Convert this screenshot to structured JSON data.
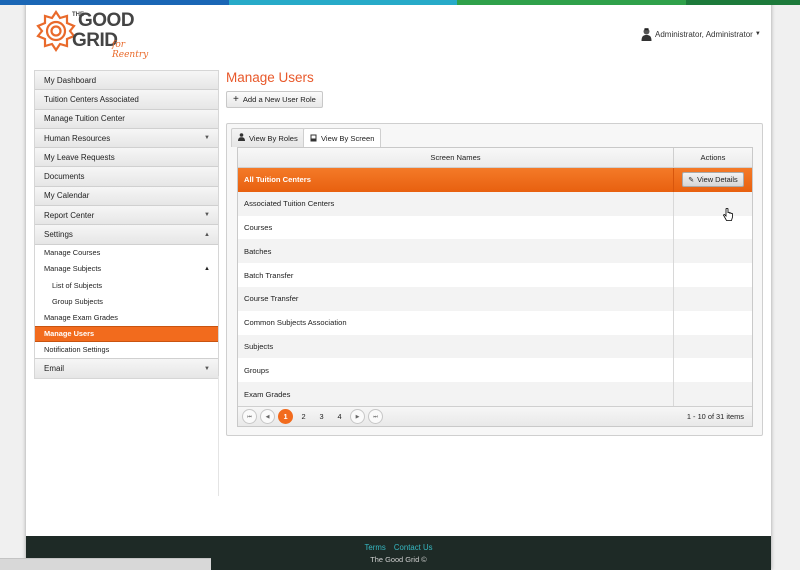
{
  "colors": {
    "topbar": [
      "#1a66b5",
      "#1a66b5",
      "#27aac8",
      "#27aac8",
      "#2fa14a",
      "#2fa14a",
      "#1d7a3b"
    ],
    "accent": "#f26b1d",
    "title": "#e8582a",
    "footer_link": "#36b8c2"
  },
  "logo": {
    "the": "THE",
    "good": "GOOD",
    "grid": "GRID",
    "tagline": "for Reentry"
  },
  "header": {
    "user_label": "Administrator, Administrator",
    "user_icon": "user-icon",
    "caret_icon": "caret-down-icon"
  },
  "sidebar": {
    "items": [
      {
        "label": "My Dashboard"
      },
      {
        "label": "Tuition Centers Associated"
      },
      {
        "label": "Manage Tuition Center"
      },
      {
        "label": "Human Resources",
        "arrow": "▼"
      },
      {
        "label": "My Leave Requests"
      },
      {
        "label": "Documents"
      },
      {
        "label": "My Calendar"
      },
      {
        "label": "Report Center",
        "arrow": "▼"
      },
      {
        "label": "Settings",
        "arrow": "▲"
      }
    ],
    "settings_sub": [
      {
        "label": "Manage Courses"
      },
      {
        "label": "Manage Subjects",
        "arrow": "▲"
      },
      {
        "label": "List of Subjects"
      },
      {
        "label": "Group Subjects"
      },
      {
        "label": "Manage Exam Grades"
      },
      {
        "label": "Manage Users"
      },
      {
        "label": "Notification Settings"
      }
    ],
    "last_item": {
      "label": "Email",
      "arrow": "▼"
    }
  },
  "main": {
    "title": "Manage Users",
    "add_button": "Add a New User Role",
    "tabs": [
      {
        "label": "View By Roles",
        "icon": "user-icon"
      },
      {
        "label": "View By Screen",
        "icon": "screen-icon"
      }
    ],
    "grid": {
      "columns": [
        "Screen Names",
        "Actions"
      ],
      "rows": [
        "All Tuition Centers",
        "Associated Tuition Centers",
        "Courses",
        "Batches",
        "Batch Transfer",
        "Course Transfer",
        "Common Subjects Association",
        "Subjects",
        "Groups",
        "Exam Grades"
      ],
      "selected_row_action": "View Details",
      "selected_row_index": 0
    },
    "pager": {
      "first": "⏮",
      "prev": "◀",
      "next": "▶",
      "last": "⏭",
      "pages": [
        "1",
        "2",
        "3",
        "4"
      ],
      "current_page": "1",
      "info": "1 - 10 of 31 items"
    }
  },
  "footer": {
    "links": [
      "Terms",
      "Contact Us"
    ],
    "copyright": "The Good Grid ©"
  }
}
